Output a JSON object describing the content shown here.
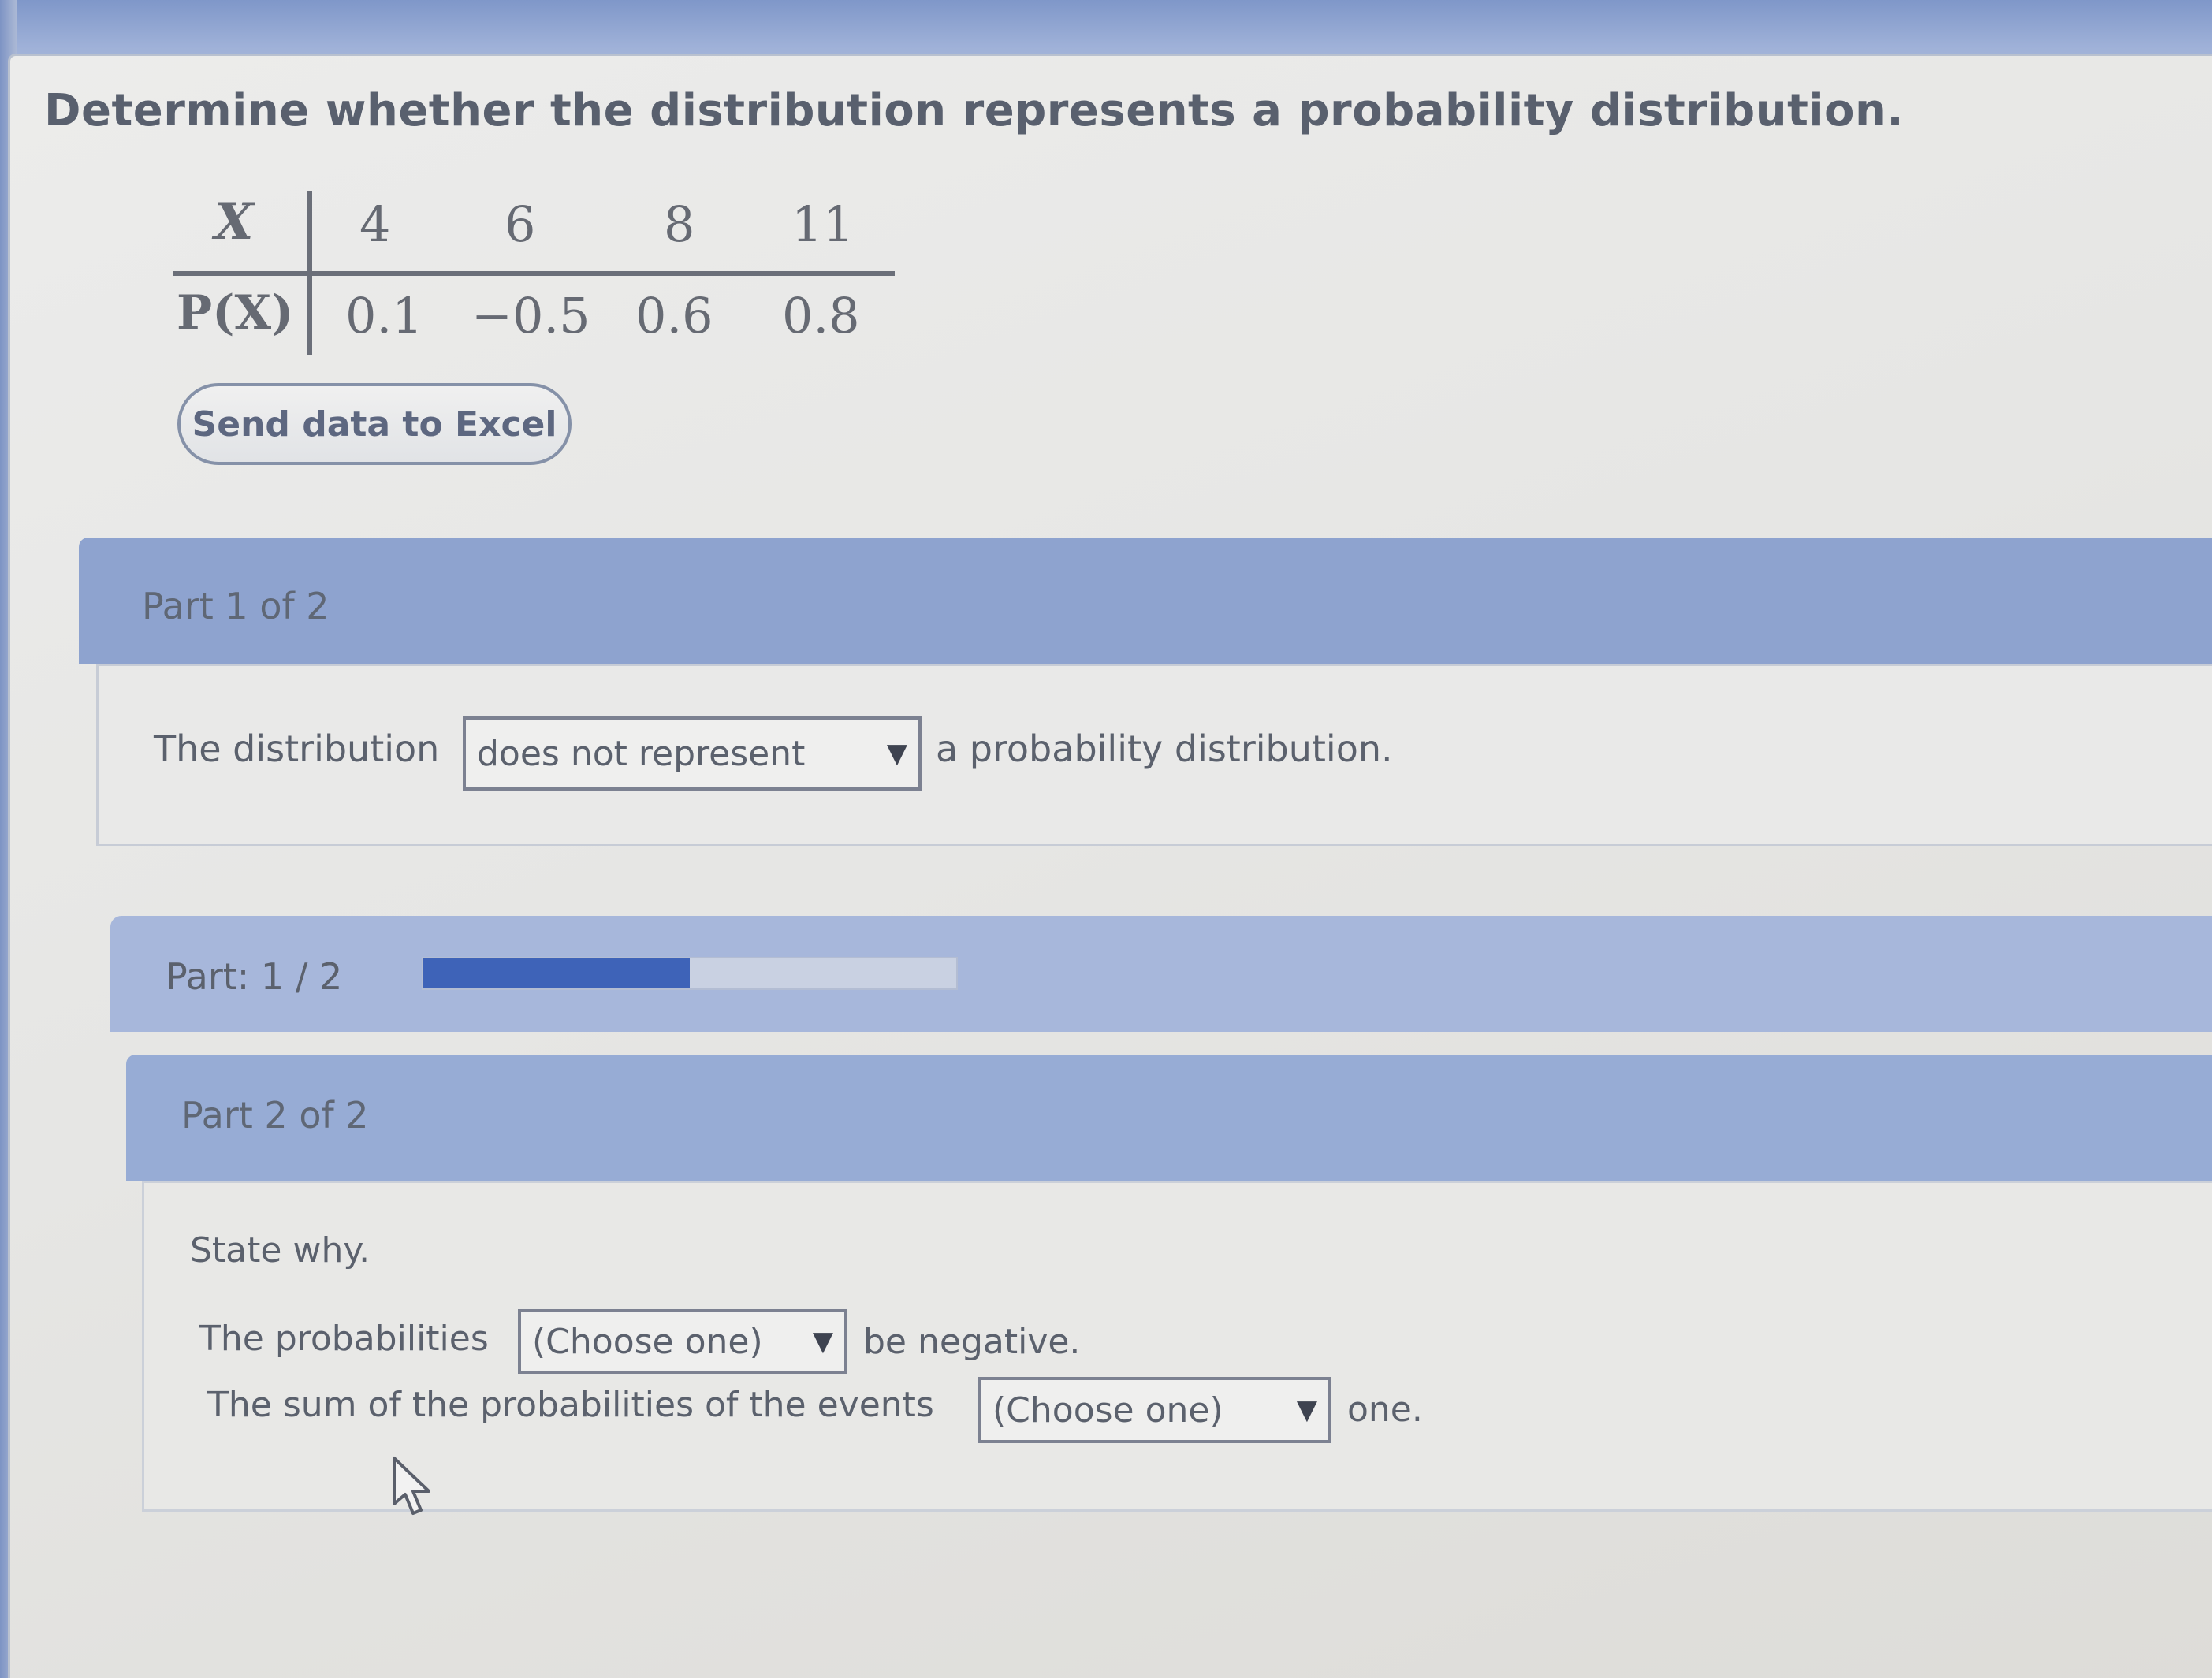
{
  "question": {
    "text": "Determine whether the distribution represents a probability distribution."
  },
  "distribution_table": {
    "row_labels": [
      "X",
      "P(X)"
    ],
    "x_values": [
      "4",
      "6",
      "8",
      "11"
    ],
    "p_values": [
      "0.1",
      "−0.5",
      "0.6",
      "0.8"
    ]
  },
  "excel_button": {
    "label": "Send data to Excel"
  },
  "part1": {
    "header": "Part 1 of 2",
    "sentence_before": "The distribution",
    "select_value": "does not represent",
    "sentence_after": "a probability distribution."
  },
  "progress": {
    "label": "Part: 1 / 2",
    "current": 1,
    "total": 2,
    "fraction": 0.5,
    "fill_color": "#3e63b8"
  },
  "part2": {
    "header": "Part 2 of 2",
    "prompt": "State why.",
    "line1_before": "The probabilities",
    "line1_select": "(Choose one)",
    "line1_after": "be negative.",
    "line2_before": "The sum of the probabilities of the events",
    "line2_select": "(Choose one)",
    "line2_after": "one."
  },
  "icons": {
    "dropdown_arrow": "▼",
    "cursor": "mouse-pointer-icon"
  },
  "colors": {
    "header_bar": "#8ea3cf",
    "progress_fill": "#3e63b8"
  }
}
